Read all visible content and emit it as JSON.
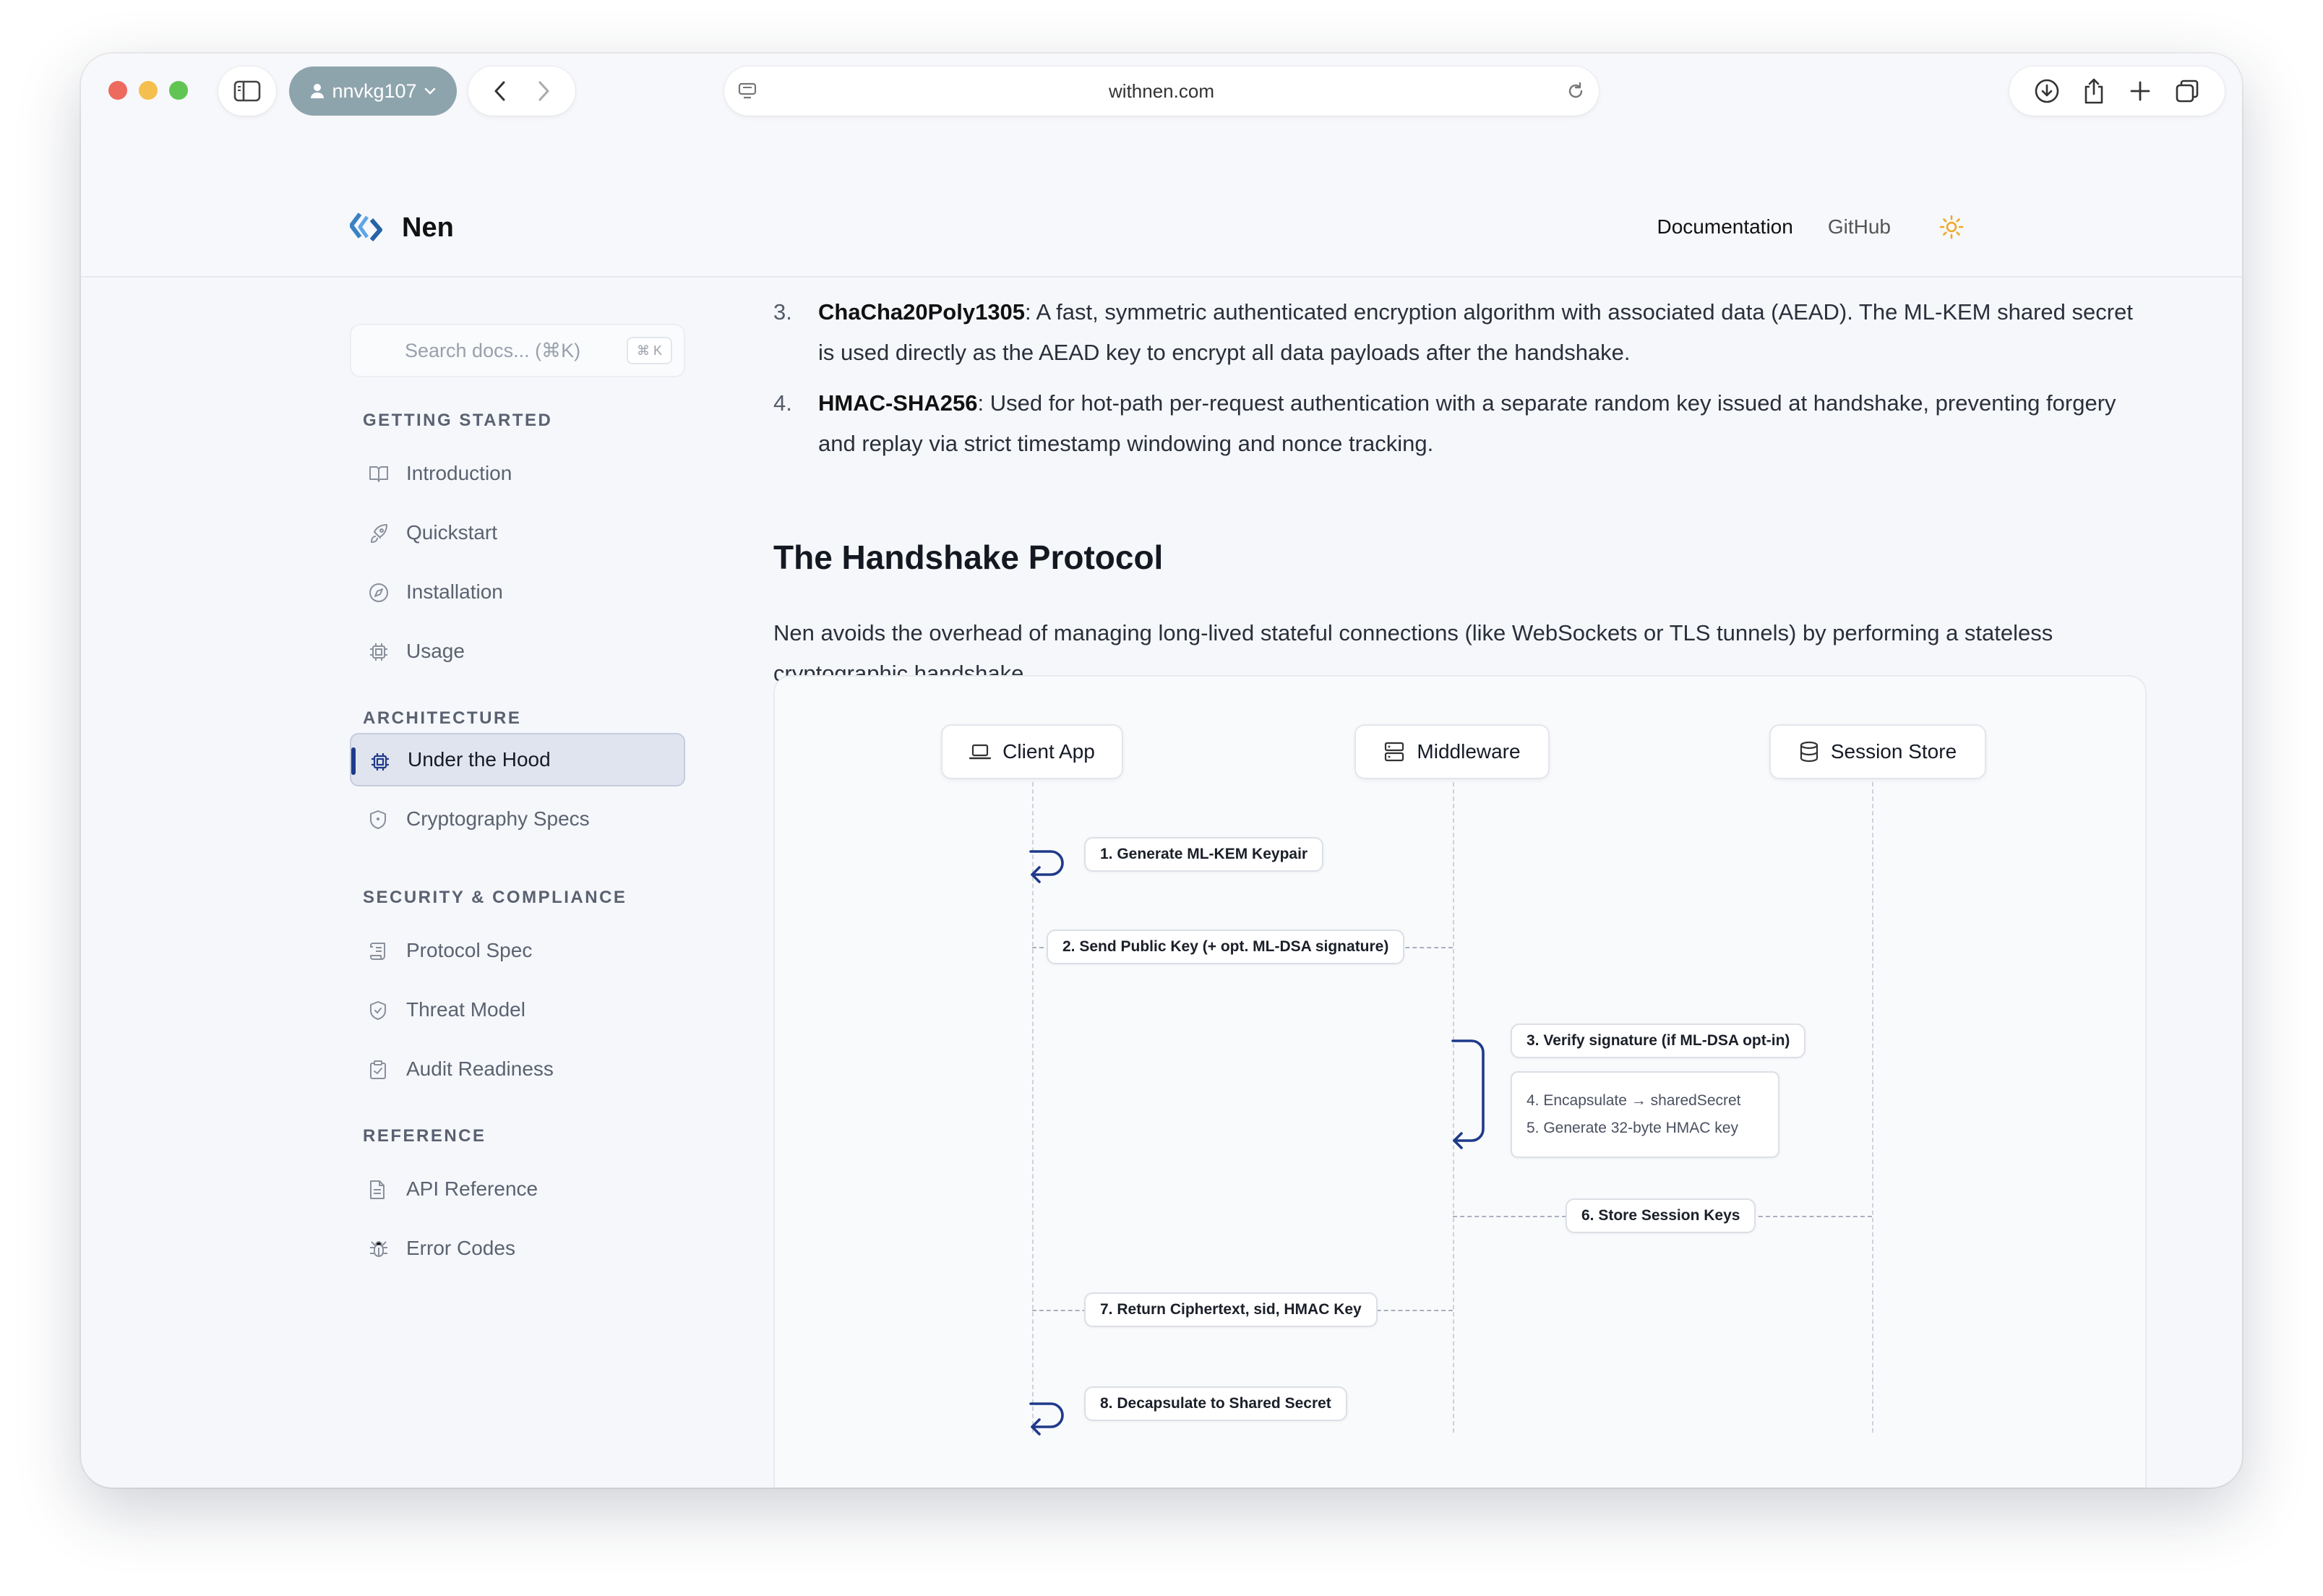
{
  "browser": {
    "profile_name": "nnvkg107",
    "url": "withnen.com"
  },
  "site": {
    "brand": "Nen",
    "nav": {
      "documentation": "Documentation",
      "github": "GitHub"
    }
  },
  "sidebar": {
    "search_placeholder": "Search docs... (⌘K)",
    "search_shortcut": "⌘ K",
    "sections": [
      {
        "title": "GETTING STARTED",
        "items": [
          {
            "label": "Introduction",
            "icon": "book-icon"
          },
          {
            "label": "Quickstart",
            "icon": "rocket-icon"
          },
          {
            "label": "Installation",
            "icon": "compass-icon"
          },
          {
            "label": "Usage",
            "icon": "cpu-icon"
          }
        ]
      },
      {
        "title": "ARCHITECTURE",
        "items": [
          {
            "label": "Under the Hood",
            "icon": "cpu-icon",
            "active": true
          },
          {
            "label": "Cryptography Specs",
            "icon": "shield-icon"
          }
        ]
      },
      {
        "title": "SECURITY & COMPLIANCE",
        "items": [
          {
            "label": "Protocol Spec",
            "icon": "scroll-icon"
          },
          {
            "label": "Threat Model",
            "icon": "shield-icon"
          },
          {
            "label": "Audit Readiness",
            "icon": "clipboard-icon"
          }
        ]
      },
      {
        "title": "REFERENCE",
        "items": [
          {
            "label": "API Reference",
            "icon": "file-icon"
          },
          {
            "label": "Error Codes",
            "icon": "bug-icon"
          }
        ]
      }
    ]
  },
  "content": {
    "list": [
      {
        "num": "3.",
        "term": "ChaCha20Poly1305",
        "text": ": A fast, symmetric authenticated encryption algorithm with associated data (AEAD). The ML-KEM shared secret is used directly as the AEAD key to encrypt all data payloads after the handshake."
      },
      {
        "num": "4.",
        "term": "HMAC-SHA256",
        "text": ": Used for hot-path per-request authentication with a separate random key issued at handshake, preventing forgery and replay via strict timestamp windowing and nonce tracking."
      }
    ],
    "heading": "The Handshake Protocol",
    "paragraph": "Nen avoids the overhead of managing long-lived stateful connections (like WebSockets or TLS tunnels) by performing a stateless cryptographic handshake."
  },
  "diagram": {
    "actors": {
      "client": "Client App",
      "middleware": "Middleware",
      "store": "Session Store"
    },
    "steps": {
      "s1": "1. Generate ML-KEM Keypair",
      "s2": "2. Send Public Key (+ opt. ML-DSA signature)",
      "s3": "3. Verify signature (if ML-DSA opt-in)",
      "s4": "4. Encapsulate → sharedSecret",
      "s5": "5. Generate 32-byte HMAC key",
      "s6": "6. Store Session Keys",
      "s7": "7. Return Ciphertext, sid, HMAC Key",
      "s8": "8. Decapsulate to Shared Secret"
    }
  }
}
